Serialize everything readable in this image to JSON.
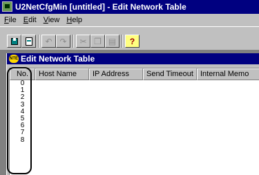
{
  "window": {
    "title": "U2NetCfgMin [untitled]  - Edit Network Table"
  },
  "menubar": {
    "items": [
      {
        "label": "File",
        "mnemonic": "F",
        "rest": "ile"
      },
      {
        "label": "Edit",
        "mnemonic": "E",
        "rest": "dit"
      },
      {
        "label": "View",
        "mnemonic": "V",
        "rest": "iew"
      },
      {
        "label": "Help",
        "mnemonic": "H",
        "rest": "elp"
      }
    ]
  },
  "toolbar": {
    "buttons": [
      {
        "name": "save-button",
        "icon": "save-icon",
        "enabled": true
      },
      {
        "name": "edit-button",
        "icon": "document-edit-icon",
        "enabled": true
      },
      {
        "name": "undo-button",
        "icon": "undo-icon",
        "enabled": false
      },
      {
        "name": "redo-button",
        "icon": "redo-icon",
        "enabled": false
      },
      {
        "name": "cut-button",
        "icon": "scissors-icon",
        "enabled": false
      },
      {
        "name": "copy-button",
        "icon": "copy-icon",
        "enabled": false
      },
      {
        "name": "paste-button",
        "icon": "paste-icon",
        "enabled": false
      },
      {
        "name": "help-button",
        "icon": "question-mark-icon",
        "enabled": true
      }
    ],
    "help_glyph": "?"
  },
  "child_window": {
    "title": "Edit Network Table",
    "icon_text": "NTE"
  },
  "table": {
    "columns": [
      "No.",
      "Host Name",
      "IP Address",
      "Send Timeout",
      "Internal Memo"
    ],
    "rows": [
      "0",
      "1",
      "2",
      "3",
      "4",
      "5",
      "6",
      "7",
      "8"
    ]
  },
  "colors": {
    "titlebar": "#000080",
    "face": "#c0c0c0",
    "mdi_background": "#808080"
  }
}
